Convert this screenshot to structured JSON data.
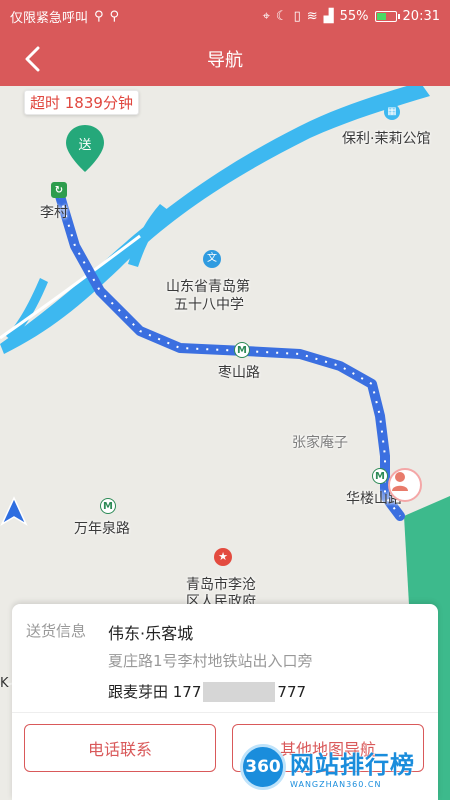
{
  "status_bar": {
    "left_text": "仅限紧急呼叫",
    "battery": "55%",
    "battery_level": 0.55,
    "time": "20:31"
  },
  "nav": {
    "title": "导航"
  },
  "map": {
    "timeout_badge": "超时 1839分钟",
    "send_marker": "送",
    "labels": {
      "li_cun": "李村",
      "poly": "保利·茉莉公馆",
      "school_line1": "山东省青岛第",
      "school_line2": "五十八中学",
      "zaoshan": "枣山路",
      "zhangjia": "张家庵子",
      "hualou": "华楼山路",
      "wannian": "万年泉路",
      "gov_line1": "青岛市李沧",
      "gov_line2": "区人民政府"
    },
    "colors": {
      "route": "#3b6fe0",
      "river": "#3db8f0",
      "park": "#3dba8c",
      "send_marker": "#25a87a"
    }
  },
  "info_card": {
    "title": "送货信息",
    "name": "伟东·乐客城",
    "address": "夏庄路1号李村地铁站出入口旁",
    "contact_prefix": "跟麦芽田 177",
    "contact_suffix": "777"
  },
  "buttons": {
    "call": "电话联系",
    "other_map": "其他地图导航"
  },
  "watermark": {
    "circle": "360",
    "main": "网站排行榜",
    "sub": "WANGZHAN360.CN"
  },
  "theme": {
    "accent": "#d9595a"
  }
}
